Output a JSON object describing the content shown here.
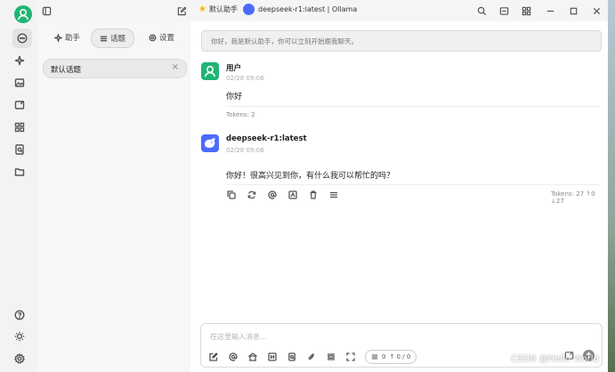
{
  "titlebar": {
    "assistant_name": "默认助手",
    "model_name": "deepseek-r1:latest | Ollama"
  },
  "topics_panel": {
    "tabs": [
      {
        "label": "助手",
        "icon": "sparkle-icon"
      },
      {
        "label": "话题",
        "icon": "list-icon",
        "active": true
      },
      {
        "label": "设置",
        "icon": "gear-icon"
      }
    ],
    "items": [
      {
        "label": "默认话题"
      }
    ]
  },
  "chat": {
    "system_prompt": "你好，我是默认助手，你可以立刻开始跟我聊天。",
    "messages": [
      {
        "role": "user",
        "name": "用户",
        "time": "02/28 09:08",
        "text": "你好",
        "tokens": "Tokens: 2"
      },
      {
        "role": "assistant",
        "name": "deepseek-r1:latest",
        "time": "02/28 09:08",
        "text": "你好！很高兴见到你，有什么我可以帮忙的吗？",
        "tokens": "Tokens: 27 ↑0 ↓27"
      }
    ]
  },
  "input": {
    "placeholder": "在这里输入消息...",
    "token_counter": "0",
    "context_counter": "↑ 0 / 0"
  },
  "watermark": "CSDN @Hello World",
  "colors": {
    "accent_green": "#1fb574",
    "deepseek_blue": "#4d6bfe"
  }
}
